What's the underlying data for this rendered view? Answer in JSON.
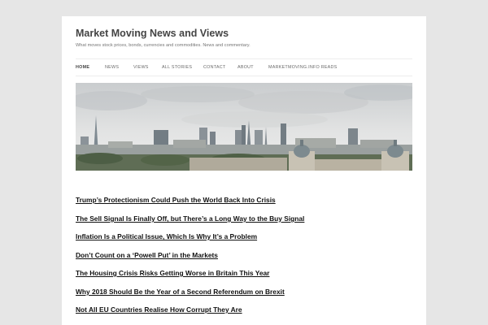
{
  "site": {
    "title": "Market Moving News and Views",
    "description": "What moves stock prices, bonds, currencies and commodities. News and commentary."
  },
  "nav": {
    "items": [
      {
        "label": "HOME",
        "active": true
      },
      {
        "label": "NEWS",
        "active": false
      },
      {
        "label": "VIEWS",
        "active": false
      },
      {
        "label": "ALL STORIES",
        "active": false
      },
      {
        "label": "CONTACT",
        "active": false
      },
      {
        "label": "ABOUT",
        "active": false
      },
      {
        "label": "MARKETMOVING.INFO READS",
        "active": false
      }
    ]
  },
  "header_image": {
    "subject": "london-skyline-photo"
  },
  "posts": [
    {
      "title": "Trump’s Protectionism Could Push the World Back Into Crisis"
    },
    {
      "title": "The Sell Signal Is Finally Off, but There’s a Long Way to the Buy Signal"
    },
    {
      "title": "Inflation Is a Political Issue, Which Is Why It’s a Problem"
    },
    {
      "title": "Don’t Count on a ‘Powell Put’ in the Markets"
    },
    {
      "title": "The Housing Crisis Risks Getting Worse in Britain This Year"
    },
    {
      "title": "Why 2018 Should Be the Year of a Second Referendum on Brexit"
    },
    {
      "title": "Not All EU Countries Realise How Corrupt They Are"
    }
  ],
  "colors": {
    "background": "#e6e6e6",
    "page": "#ffffff",
    "title": "#444444",
    "link": "#111111"
  }
}
